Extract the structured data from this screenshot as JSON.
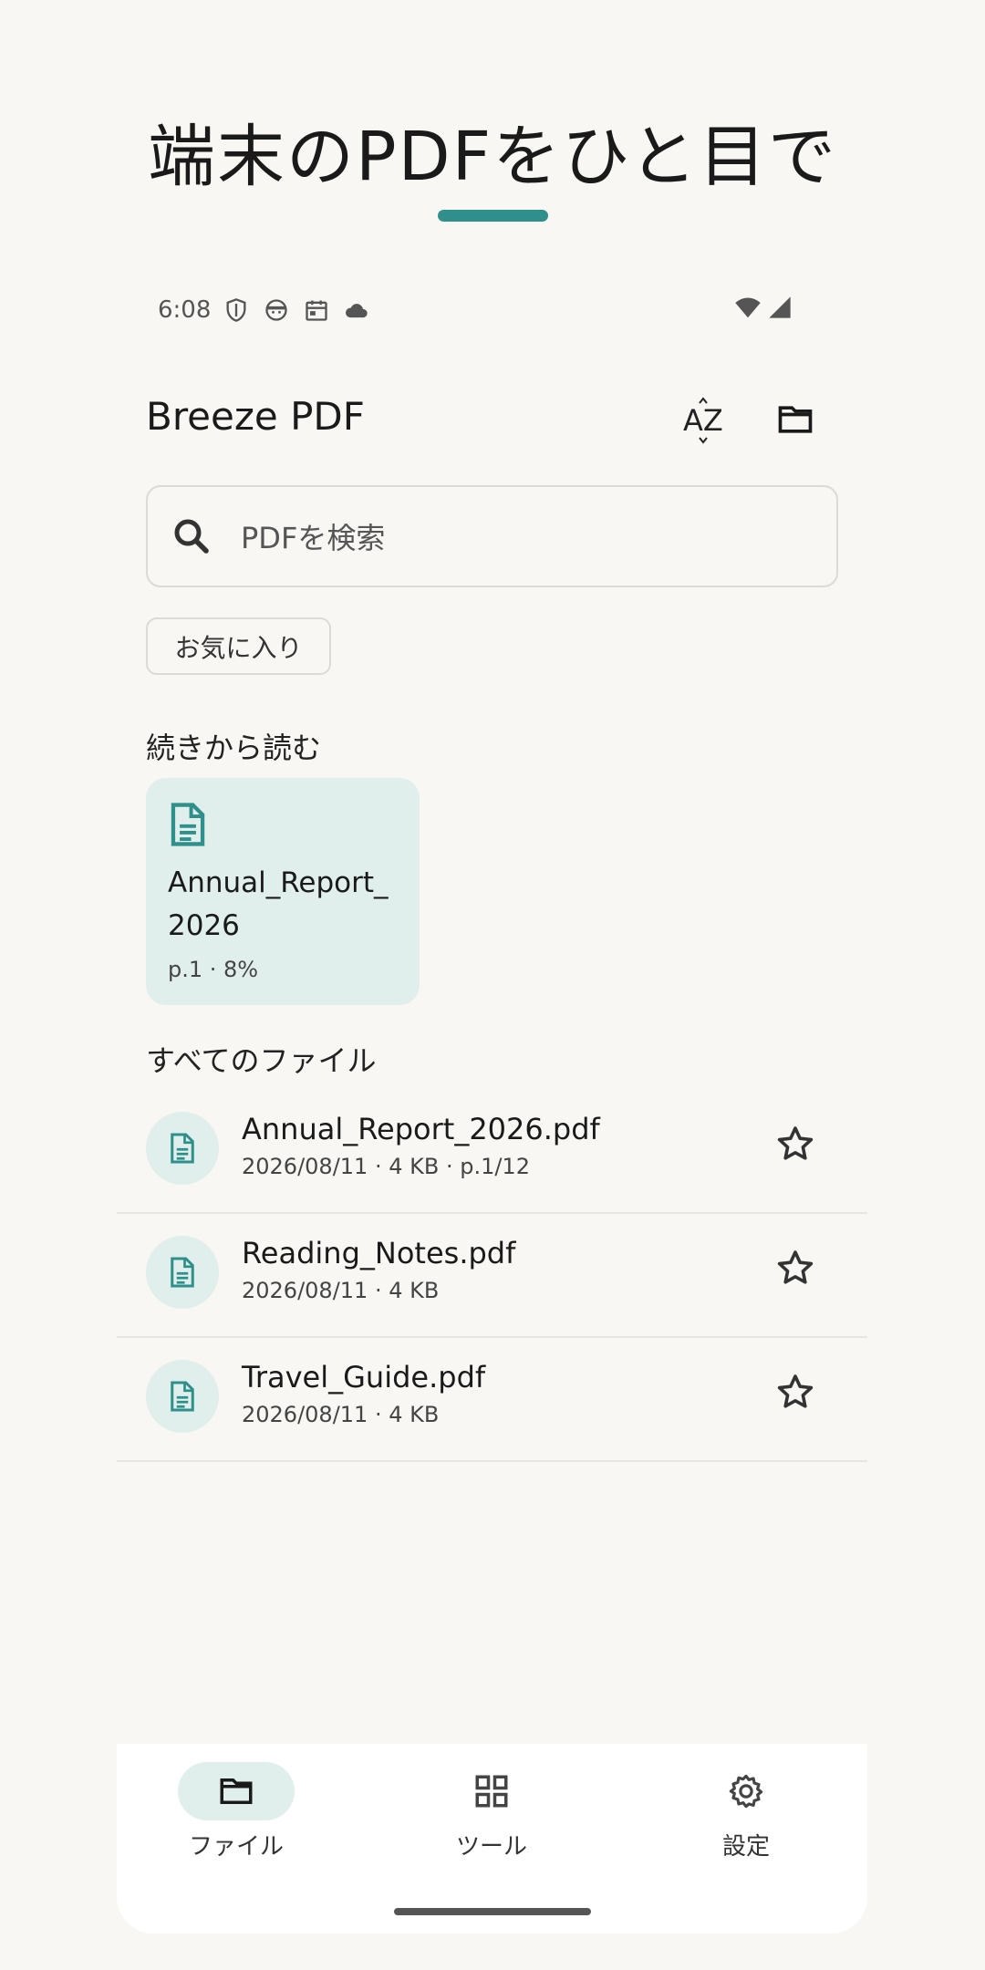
{
  "headline": "端末のPDFをひと目で",
  "status": {
    "time": "6:08"
  },
  "appbar": {
    "title": "Breeze PDF",
    "sort_label": "AZ"
  },
  "search": {
    "placeholder": "PDFを検索"
  },
  "filter_chip": {
    "label": "お気に入り"
  },
  "continue_section": {
    "title": "続きから読む",
    "card": {
      "title": "Annual_Report_2026",
      "meta": "p.1 · 8%"
    }
  },
  "files_section": {
    "title": "すべてのファイル",
    "items": [
      {
        "name": "Annual_Report_2026.pdf",
        "meta": "2026/08/11 · 4 KB · p.1/12"
      },
      {
        "name": "Reading_Notes.pdf",
        "meta": "2026/08/11 · 4 KB"
      },
      {
        "name": "Travel_Guide.pdf",
        "meta": "2026/08/11 · 4 KB"
      }
    ]
  },
  "bottom_nav": {
    "items": [
      {
        "label": "ファイル",
        "icon": "folder-icon",
        "active": true
      },
      {
        "label": "ツール",
        "icon": "grid-icon",
        "active": false
      },
      {
        "label": "設定",
        "icon": "gear-icon",
        "active": false
      }
    ]
  },
  "colors": {
    "accent": "#2f8f8b",
    "card_bg": "#e0efec",
    "background": "#f8f7f4"
  }
}
